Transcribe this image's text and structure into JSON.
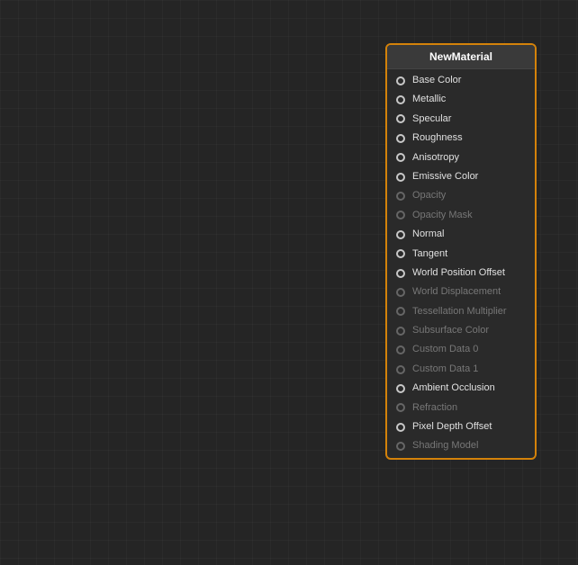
{
  "node": {
    "title": "NewMaterial",
    "accent_color": "#d4820a",
    "pins": [
      {
        "id": "base-color",
        "label": "Base Color",
        "active": true
      },
      {
        "id": "metallic",
        "label": "Metallic",
        "active": true
      },
      {
        "id": "specular",
        "label": "Specular",
        "active": true
      },
      {
        "id": "roughness",
        "label": "Roughness",
        "active": true
      },
      {
        "id": "anisotropy",
        "label": "Anisotropy",
        "active": true
      },
      {
        "id": "emissive-color",
        "label": "Emissive Color",
        "active": true
      },
      {
        "id": "opacity",
        "label": "Opacity",
        "active": false
      },
      {
        "id": "opacity-mask",
        "label": "Opacity Mask",
        "active": false
      },
      {
        "id": "normal",
        "label": "Normal",
        "active": true
      },
      {
        "id": "tangent",
        "label": "Tangent",
        "active": true
      },
      {
        "id": "world-position-offset",
        "label": "World Position Offset",
        "active": true
      },
      {
        "id": "world-displacement",
        "label": "World Displacement",
        "active": false
      },
      {
        "id": "tessellation-multiplier",
        "label": "Tessellation Multiplier",
        "active": false
      },
      {
        "id": "subsurface-color",
        "label": "Subsurface Color",
        "active": false
      },
      {
        "id": "custom-data-0",
        "label": "Custom Data 0",
        "active": false
      },
      {
        "id": "custom-data-1",
        "label": "Custom Data 1",
        "active": false
      },
      {
        "id": "ambient-occlusion",
        "label": "Ambient Occlusion",
        "active": true
      },
      {
        "id": "refraction",
        "label": "Refraction",
        "active": false
      },
      {
        "id": "pixel-depth-offset",
        "label": "Pixel Depth Offset",
        "active": true
      },
      {
        "id": "shading-model",
        "label": "Shading Model",
        "active": false
      }
    ]
  }
}
